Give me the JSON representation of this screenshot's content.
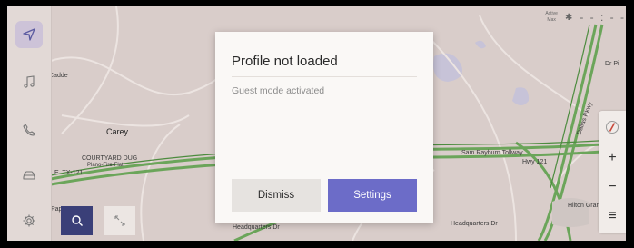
{
  "status": {
    "signal_label": "Active\nMax",
    "bluetooth_icon": "bluetooth-icon",
    "time_placeholder": "- - : - -"
  },
  "sidebar": {
    "items": [
      {
        "name": "navigation",
        "icon": "navigation-arrow-icon",
        "active": true
      },
      {
        "name": "music",
        "icon": "music-note-icon",
        "active": false
      },
      {
        "name": "phone",
        "icon": "phone-icon",
        "active": false
      },
      {
        "name": "vehicle",
        "icon": "car-icon",
        "active": false
      },
      {
        "name": "settings",
        "icon": "gear-icon",
        "active": false
      }
    ]
  },
  "map": {
    "labels": {
      "carey": "Carey",
      "courtyard": "COURTYARD DUG",
      "courtyard2": "Plano-Fire-Flat",
      "lbj": "E. TX-121",
      "sam_rayburn": "Sam Rayburn Tollway",
      "hwy121": "Hwy 121",
      "headquarters": "Headquarters Dr",
      "headquarters2": "Headquarters Dr",
      "legacy": "Legacy Dr",
      "mall": "Cadde",
      "dallas_pkwy": "Dallas Pkwy",
      "pape": "Pape",
      "hilton": "Hilton Grand",
      "dr_top": "Dr Pi"
    }
  },
  "controls": {
    "zoom_in": "+",
    "zoom_out": "−",
    "menu": "≡",
    "compass_icon": "compass-icon",
    "search_icon": "search-icon",
    "expand_icon": "expand-arrows-icon"
  },
  "dialog": {
    "title": "Profile not loaded",
    "message": "Guest mode activated",
    "dismiss_label": "Dismiss",
    "settings_label": "Settings"
  },
  "colors": {
    "accent": "#6c6cc8",
    "search_fab": "#3a3f78",
    "road_green": "#5a9a4a"
  }
}
